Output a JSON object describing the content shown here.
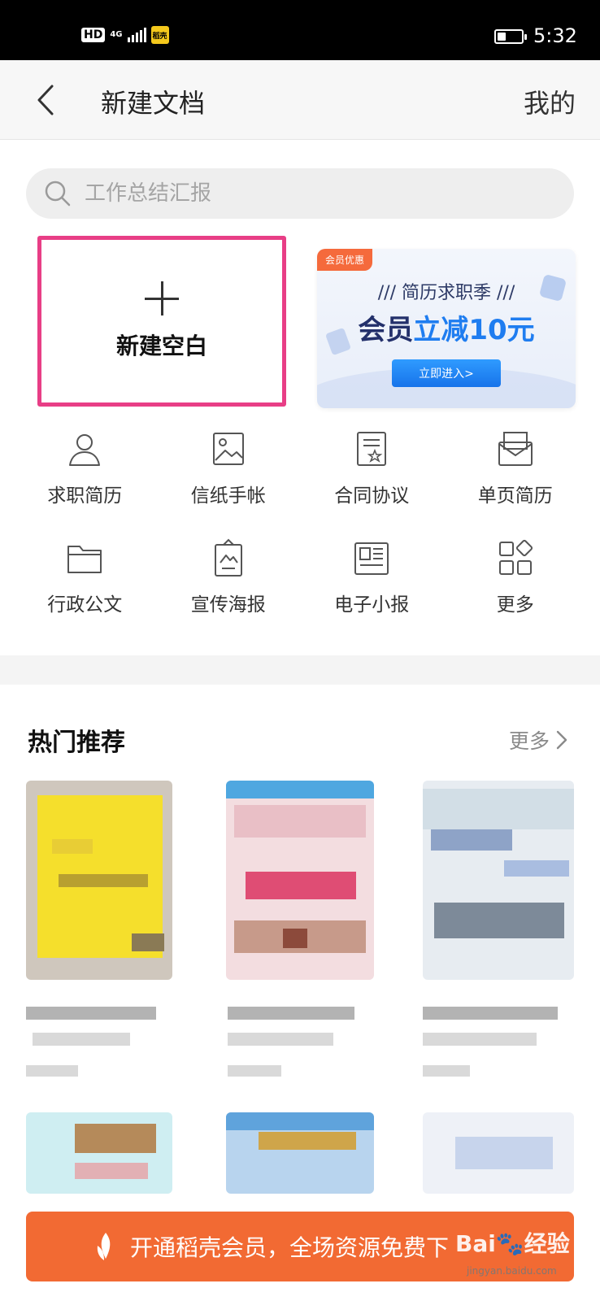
{
  "status_bar": {
    "hd": "HD",
    "network": "4G",
    "time": "5:32",
    "battery_level": 0.35
  },
  "nav": {
    "title": "新建文档",
    "right_label": "我的"
  },
  "search": {
    "placeholder": "工作总结汇报"
  },
  "new_blank": {
    "label": "新建空白"
  },
  "promo": {
    "tag": "会员优惠",
    "subtitle": "/// 简历求职季 ///",
    "headline_a": "会员",
    "headline_b": "立减10元",
    "button": "立即进入>"
  },
  "categories": [
    {
      "label": "求职简历",
      "icon": "person-icon"
    },
    {
      "label": "信纸手帐",
      "icon": "image-icon"
    },
    {
      "label": "合同协议",
      "icon": "contract-icon"
    },
    {
      "label": "单页简历",
      "icon": "envelope-icon"
    },
    {
      "label": "行政公文",
      "icon": "folder-icon"
    },
    {
      "label": "宣传海报",
      "icon": "poster-icon"
    },
    {
      "label": "电子小报",
      "icon": "newspaper-icon"
    },
    {
      "label": "更多",
      "icon": "grid-more-icon"
    }
  ],
  "hot": {
    "title": "热门推荐",
    "more": "更多"
  },
  "vip_bar": {
    "text": "开通稻壳会员，全场资源免费下"
  },
  "watermark": {
    "brand": "Bai",
    "brand_b": "经验",
    "url": "jingyan.baidu.com"
  },
  "colors": {
    "accent": "#f26a33",
    "highlight_border": "#e83e86",
    "promo_blue": "#1f7df0"
  }
}
